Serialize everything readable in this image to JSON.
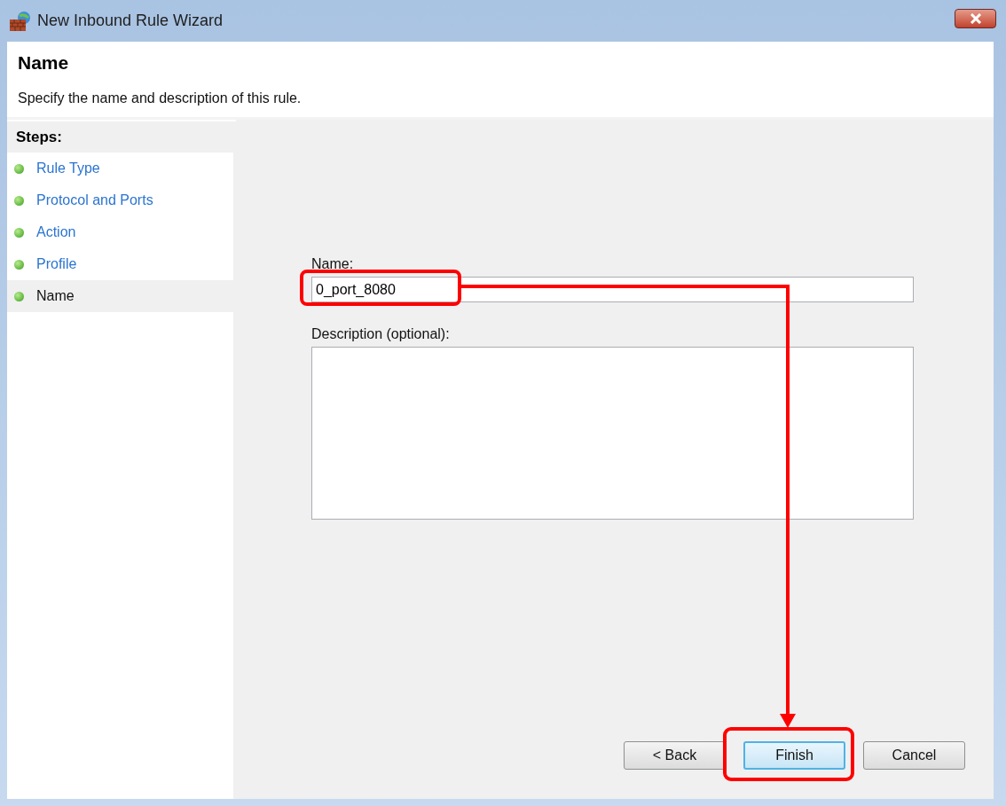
{
  "window": {
    "title": "New Inbound Rule Wizard"
  },
  "header": {
    "title": "Name",
    "subtitle": "Specify the name and description of this rule."
  },
  "steps": {
    "heading": "Steps:",
    "items": [
      {
        "label": "Rule Type",
        "selected": false
      },
      {
        "label": "Protocol and Ports",
        "selected": false
      },
      {
        "label": "Action",
        "selected": false
      },
      {
        "label": "Profile",
        "selected": false
      },
      {
        "label": "Name",
        "selected": true
      }
    ]
  },
  "form": {
    "name_label": "Name:",
    "name_value": "0_port_8080",
    "description_label": "Description (optional):"
  },
  "buttons": [
    {
      "label": "< Back",
      "default": false
    },
    {
      "label": "Finish",
      "default": true
    },
    {
      "label": "Cancel",
      "default": false
    }
  ]
}
